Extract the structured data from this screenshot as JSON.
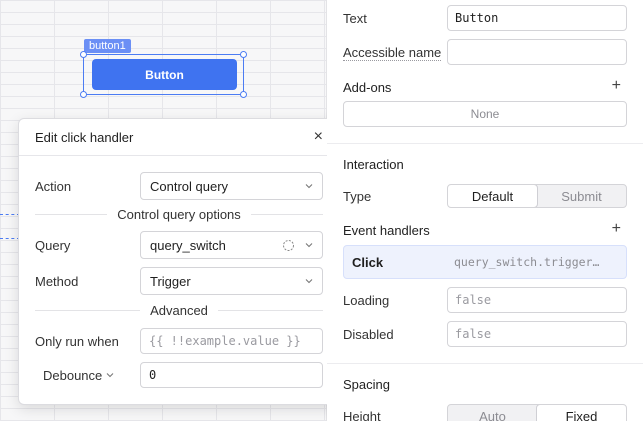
{
  "canvas": {
    "component_tag": "button1",
    "button_label": "Button"
  },
  "popover": {
    "title": "Edit click handler",
    "close_icon": "×",
    "action": {
      "label": "Action",
      "value": "Control query"
    },
    "section_query_options": "Control query options",
    "query": {
      "label": "Query",
      "value": "query_switch"
    },
    "method": {
      "label": "Method",
      "value": "Trigger"
    },
    "section_advanced": "Advanced",
    "only_run_when": {
      "label": "Only run when",
      "placeholder": "{{ !!example.value }}"
    },
    "debounce": {
      "label": "Debounce",
      "value": "0"
    }
  },
  "panel": {
    "text": {
      "label": "Text",
      "value": "Button"
    },
    "accessible_name": {
      "label": "Accessible name",
      "value": ""
    },
    "addons": {
      "label": "Add-ons",
      "plus": "+",
      "value": "None"
    },
    "interaction": {
      "title": "Interaction",
      "type_label": "Type",
      "type_options": [
        "Default",
        "Submit"
      ],
      "type_selected": "Default",
      "event_handlers_label": "Event handlers",
      "plus": "+",
      "handler": {
        "event": "Click",
        "action": "query_switch.trigger…"
      },
      "loading": {
        "label": "Loading",
        "placeholder": "false"
      },
      "disabled": {
        "label": "Disabled",
        "placeholder": "false"
      }
    },
    "spacing": {
      "title": "Spacing",
      "height_label": "Height",
      "height_options": [
        "Auto",
        "Fixed"
      ],
      "height_selected": "Fixed"
    }
  },
  "colors": {
    "accent": "#3f73f0",
    "selection": "#4c7cf3",
    "handler_bg": "#eef2fd"
  },
  "icons": {
    "close": "close-icon",
    "chevron": "chevron-down-icon",
    "crosshair": "crosshair-icon",
    "plus": "plus-icon"
  }
}
